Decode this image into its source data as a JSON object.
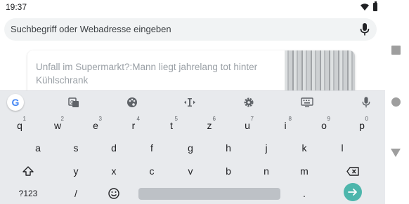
{
  "status_bar": {
    "time": "19:37",
    "wifi_icon": "wifi-icon",
    "battery_icon": "battery-icon"
  },
  "url_bar": {
    "placeholder": "Suchbegriff oder Webadresse eingeben",
    "mic_icon": "mic-icon"
  },
  "article": {
    "title": "Unfall im Supermarkt?:Mann liegt jahrelang tot hinter Kühlschrank"
  },
  "keyboard": {
    "toolbar": {
      "google_logo": "G",
      "items": [
        "translate-icon",
        "palette-icon",
        "text-cursor-icon",
        "gear-icon",
        "keyboard-icon",
        "mic-icon"
      ]
    },
    "row1": [
      {
        "key": "q",
        "hint": "1"
      },
      {
        "key": "w",
        "hint": "2"
      },
      {
        "key": "e",
        "hint": "3"
      },
      {
        "key": "r",
        "hint": "4"
      },
      {
        "key": "t",
        "hint": "5"
      },
      {
        "key": "z",
        "hint": "6"
      },
      {
        "key": "u",
        "hint": "7"
      },
      {
        "key": "i",
        "hint": "8"
      },
      {
        "key": "o",
        "hint": "9"
      },
      {
        "key": "p",
        "hint": "0"
      }
    ],
    "row2": [
      "a",
      "s",
      "d",
      "f",
      "g",
      "h",
      "j",
      "k",
      "l"
    ],
    "row3": [
      "y",
      "x",
      "c",
      "v",
      "b",
      "n",
      "m"
    ],
    "row4": {
      "symbols": "?123",
      "slash": "/",
      "period": "."
    },
    "colors": {
      "enter": "#4db6ac",
      "background": "#e8eaed"
    }
  }
}
